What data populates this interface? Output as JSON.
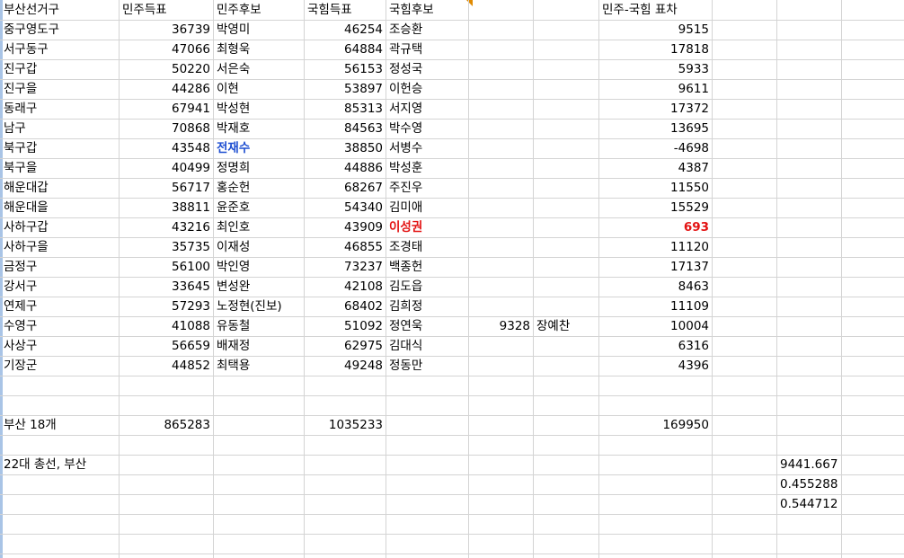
{
  "header": {
    "district": "부산선거구",
    "dem_votes": "민주득표",
    "dem_candidate": "민주후보",
    "ppp_votes": "국힘득표",
    "ppp_candidate": "국힘후보",
    "diff": "민주-국힘 표차"
  },
  "rows": [
    {
      "district": "중구영도구",
      "dem_votes": "36739",
      "dem_cand": "박영미",
      "ppp_votes": "46254",
      "ppp_cand": "조승환",
      "diff": "9515"
    },
    {
      "district": "서구동구",
      "dem_votes": "47066",
      "dem_cand": "최형욱",
      "ppp_votes": "64884",
      "ppp_cand": "곽규택",
      "diff": "17818"
    },
    {
      "district": "진구갑",
      "dem_votes": "50220",
      "dem_cand": "서은숙",
      "ppp_votes": "56153",
      "ppp_cand": "정성국",
      "diff": "5933"
    },
    {
      "district": "진구을",
      "dem_votes": "44286",
      "dem_cand": "이현",
      "ppp_votes": "53897",
      "ppp_cand": "이헌승",
      "diff": "9611"
    },
    {
      "district": "동래구",
      "dem_votes": "67941",
      "dem_cand": "박성현",
      "ppp_votes": "85313",
      "ppp_cand": "서지영",
      "diff": "17372"
    },
    {
      "district": "남구",
      "dem_votes": "70868",
      "dem_cand": "박재호",
      "ppp_votes": "84563",
      "ppp_cand": "박수영",
      "diff": "13695"
    },
    {
      "district": "북구갑",
      "dem_votes": "43548",
      "dem_cand": "전재수",
      "ppp_votes": "38850",
      "ppp_cand": "서병수",
      "diff": "-4698",
      "dem_style": "blue"
    },
    {
      "district": "북구을",
      "dem_votes": "40499",
      "dem_cand": "정명희",
      "ppp_votes": "44886",
      "ppp_cand": "박성훈",
      "diff": "4387"
    },
    {
      "district": "해운대갑",
      "dem_votes": "56717",
      "dem_cand": "홍순헌",
      "ppp_votes": "68267",
      "ppp_cand": "주진우",
      "diff": "11550"
    },
    {
      "district": "해운대을",
      "dem_votes": "38811",
      "dem_cand": "윤준호",
      "ppp_votes": "54340",
      "ppp_cand": "김미애",
      "diff": "15529"
    },
    {
      "district": "사하구갑",
      "dem_votes": "43216",
      "dem_cand": "최인호",
      "ppp_votes": "43909",
      "ppp_cand": "이성권",
      "diff": "693",
      "ppp_style": "red",
      "diff_style": "red"
    },
    {
      "district": "사하구을",
      "dem_votes": "35735",
      "dem_cand": "이재성",
      "ppp_votes": "46855",
      "ppp_cand": "조경태",
      "diff": "11120"
    },
    {
      "district": "금정구",
      "dem_votes": "56100",
      "dem_cand": "박인영",
      "ppp_votes": "73237",
      "ppp_cand": "백종헌",
      "diff": "17137"
    },
    {
      "district": "강서구",
      "dem_votes": "33645",
      "dem_cand": "변성완",
      "ppp_votes": "42108",
      "ppp_cand": "김도읍",
      "diff": "8463"
    },
    {
      "district": "연제구",
      "dem_votes": "57293",
      "dem_cand": "노정현(진보)",
      "ppp_votes": "68402",
      "ppp_cand": "김희정",
      "diff": "11109"
    },
    {
      "district": "수영구",
      "dem_votes": "41088",
      "dem_cand": "유동철",
      "ppp_votes": "51092",
      "ppp_cand": "정연욱",
      "extra_votes": "9328",
      "extra_cand": "장예찬",
      "diff": "10004"
    },
    {
      "district": "사상구",
      "dem_votes": "56659",
      "dem_cand": "배재정",
      "ppp_votes": "62975",
      "ppp_cand": "김대식",
      "diff": "6316"
    },
    {
      "district": "기장군",
      "dem_votes": "44852",
      "dem_cand": "최택용",
      "ppp_votes": "49248",
      "ppp_cand": "정동만",
      "diff": "4396"
    }
  ],
  "total": {
    "label": "부산 18개",
    "dem_votes": "865283",
    "ppp_votes": "1035233",
    "diff": "169950"
  },
  "footer": {
    "note": "22대 총선, 부산",
    "stats": [
      "9441.667",
      "0.455288",
      "0.544712"
    ]
  },
  "colors": {
    "blue_highlight": "#1f4fd1",
    "red_highlight": "#e31313",
    "gridline": "#d4d4d4",
    "comment_marker": "#e08a00"
  }
}
